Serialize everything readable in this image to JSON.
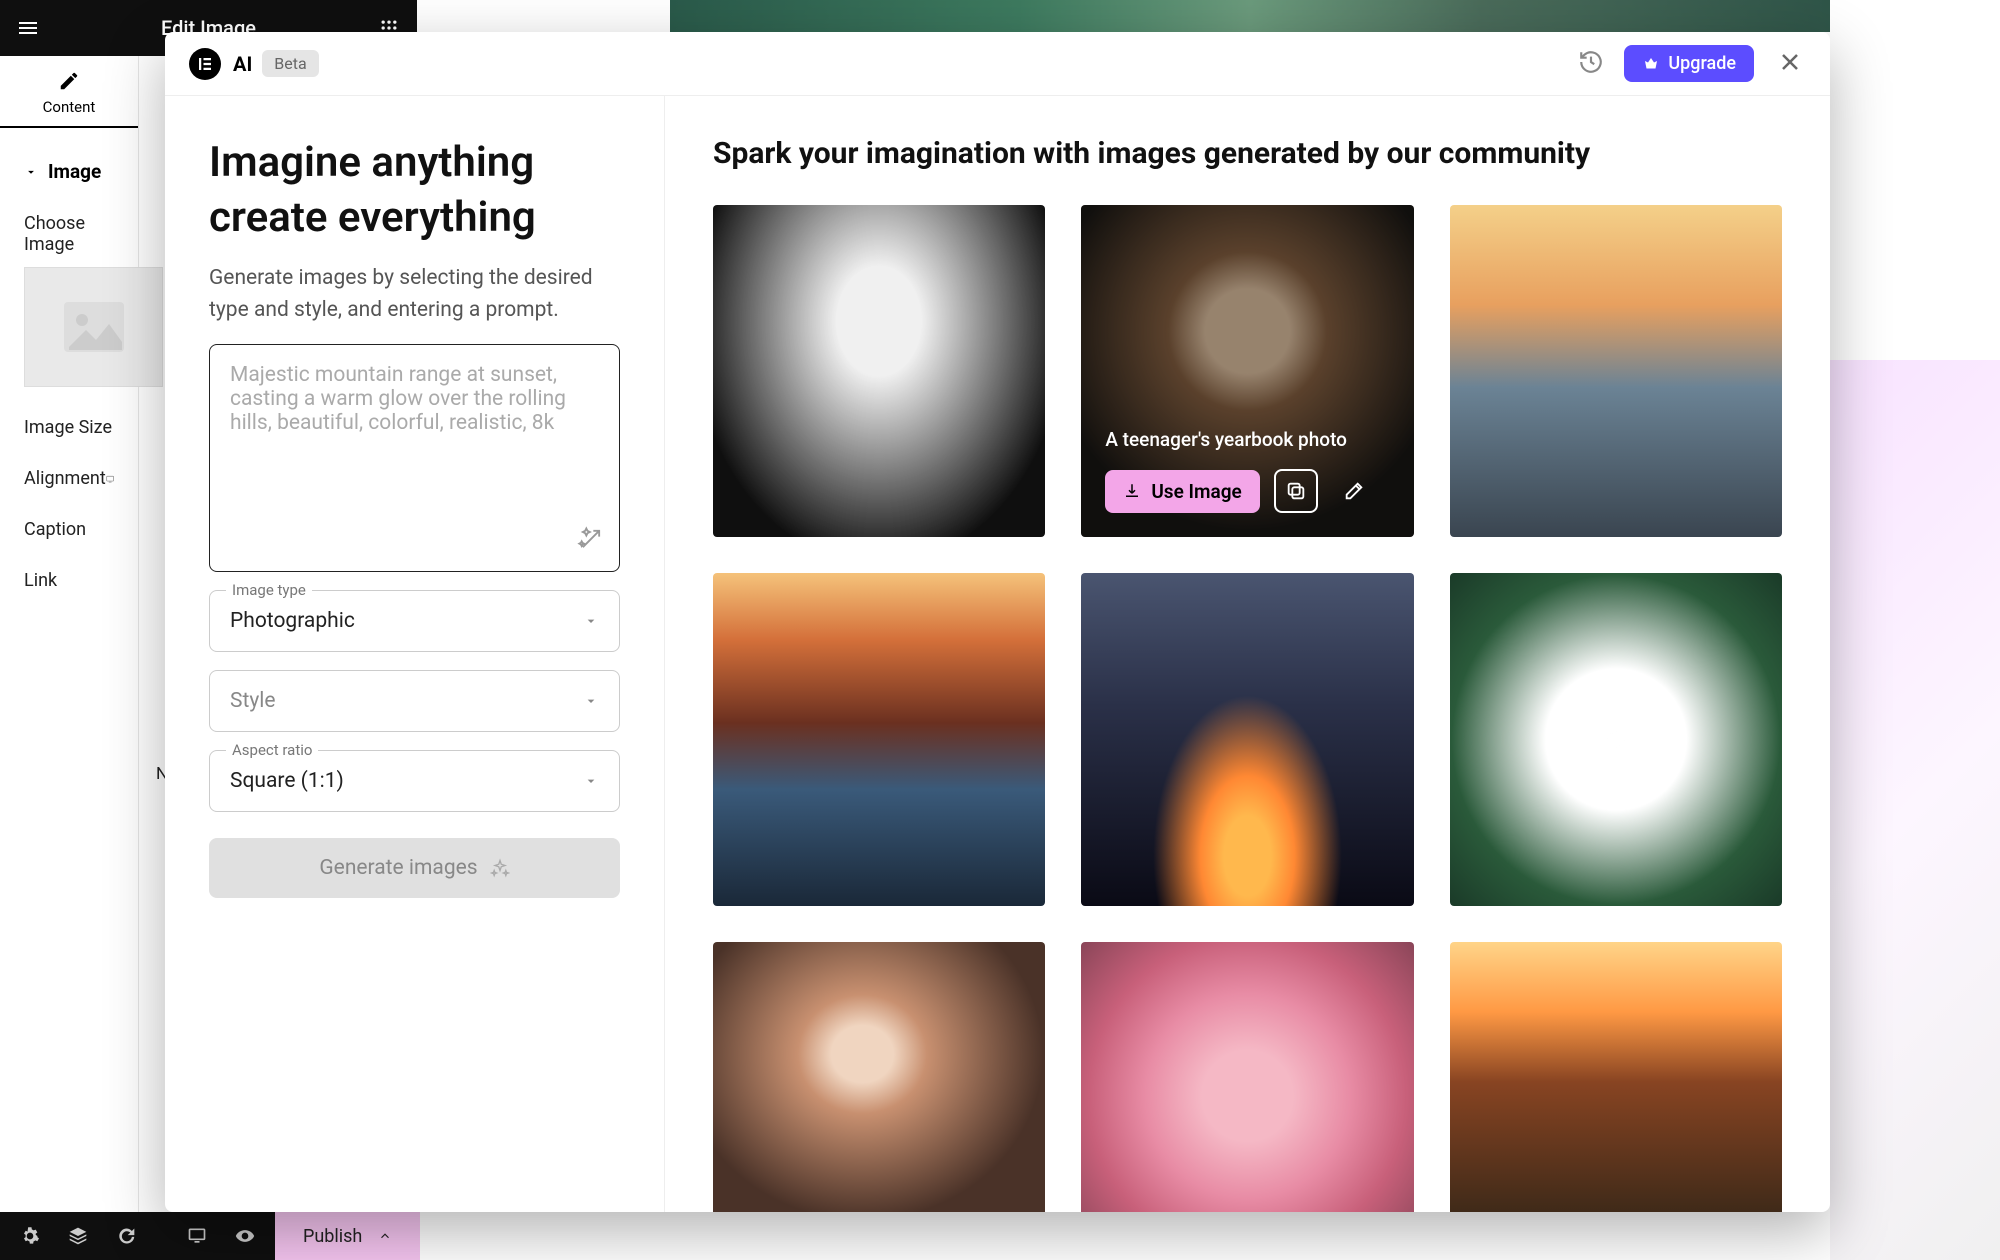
{
  "editor": {
    "title": "Edit Image",
    "tab_content": "Content",
    "section_image": "Image",
    "choose_image": "Choose Image",
    "image_size": "Image Size",
    "alignment": "Alignment",
    "caption": "Caption",
    "link": "Link",
    "publish": "Publish",
    "n": "N"
  },
  "ai": {
    "brand": "AI",
    "badge": "Beta",
    "upgrade": "Upgrade",
    "heading": "Imagine anything create everything",
    "description": "Generate images by selecting the desired type and style, and entering a prompt.",
    "prompt_placeholder": "Majestic mountain range at sunset, casting a warm glow over the rolling hills, beautiful, colorful, realistic, 8k",
    "image_type_label": "Image type",
    "image_type_value": "Photographic",
    "style_label": "Style",
    "aspect_label": "Aspect ratio",
    "aspect_value": "Square (1:1)",
    "generate": "Generate images",
    "gallery_heading": "Spark your imagination with images generated by our community",
    "hover_caption": "A teenager's yearbook photo",
    "use_image": "Use Image"
  }
}
